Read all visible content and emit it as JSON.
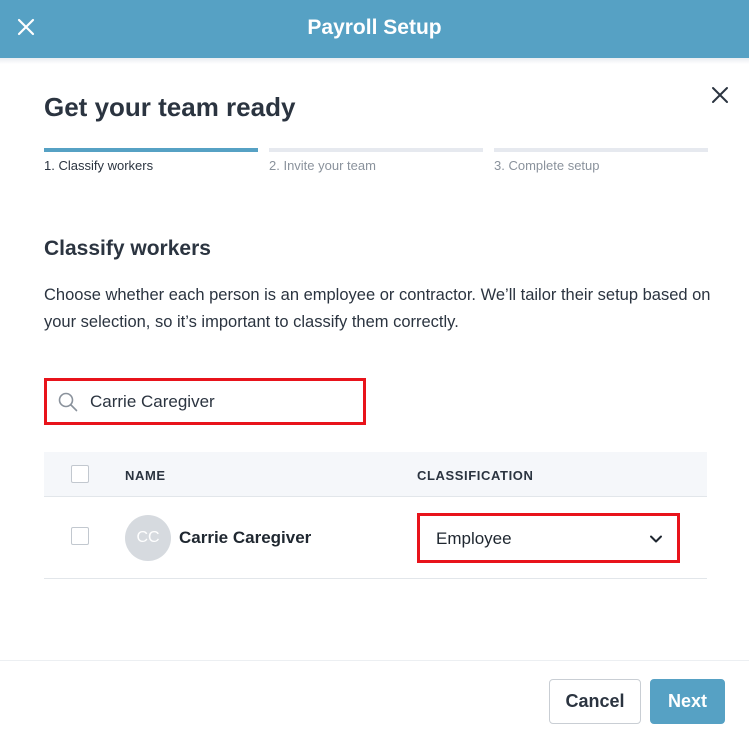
{
  "header": {
    "title": "Payroll Setup",
    "close_icon": "close-icon",
    "background_color": "#56a1c4"
  },
  "panel": {
    "close_icon": "close-icon",
    "heading": "Get your team ready"
  },
  "steps": [
    {
      "label": "1. Classify workers",
      "active": true
    },
    {
      "label": "2. Invite your team",
      "active": false
    },
    {
      "label": "3. Complete setup",
      "active": false
    }
  ],
  "section": {
    "title": "Classify workers",
    "description": "Choose whether each person is an employee or contractor. We’ll tailor their setup based on your selection, so it’s important to classify them correctly."
  },
  "search": {
    "icon": "search-icon",
    "value": "Carrie Caregiver",
    "placeholder": ""
  },
  "table": {
    "columns": [
      "NAME",
      "CLASSIFICATION"
    ],
    "rows": [
      {
        "initials": "CC",
        "name": "Carrie Caregiver",
        "classification": "Employee",
        "selected": false
      }
    ]
  },
  "footer": {
    "cancel_label": "Cancel",
    "next_label": "Next"
  },
  "colors": {
    "accent": "#56a1c4",
    "highlight": "#e8131b",
    "text": "#2b3440"
  }
}
